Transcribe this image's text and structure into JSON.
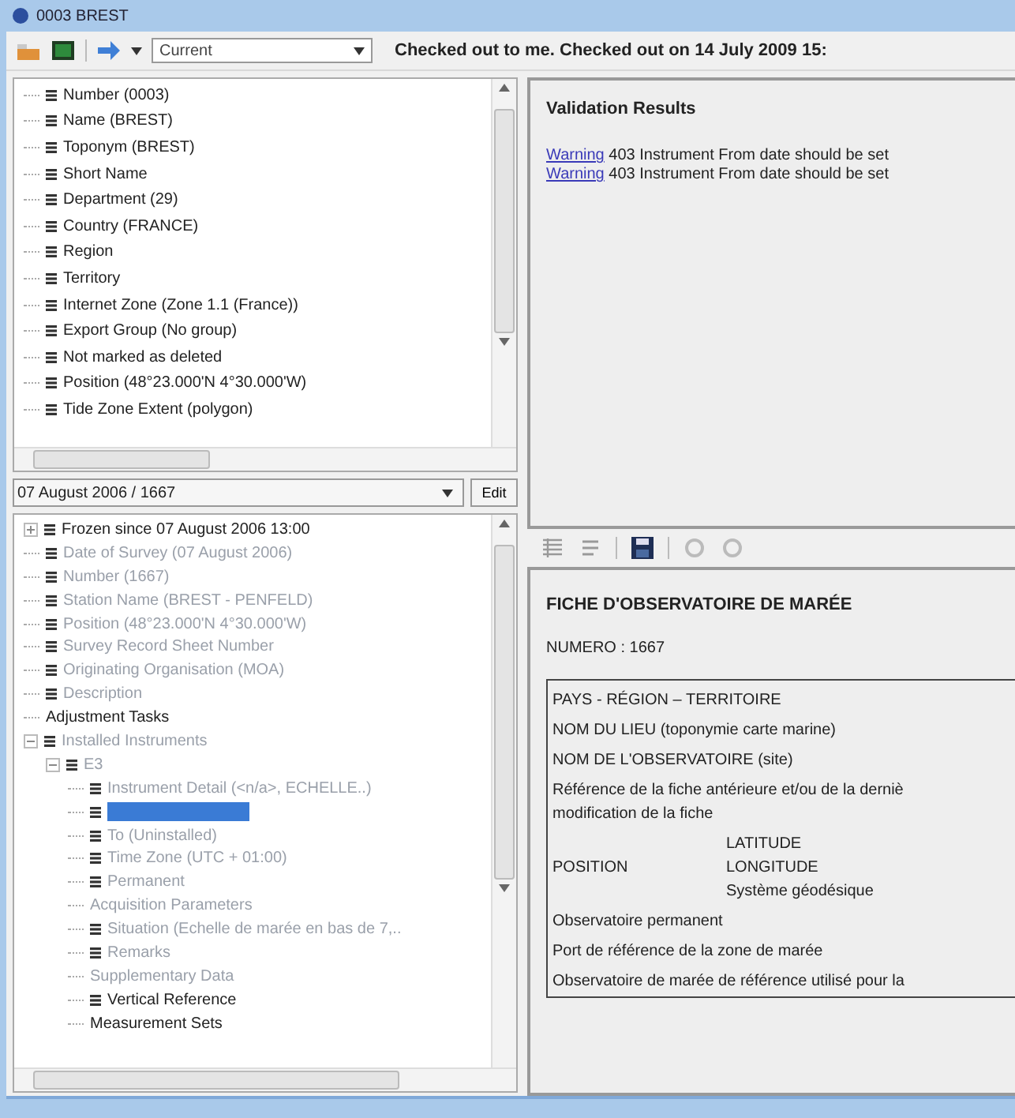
{
  "window": {
    "title": "0003 BREST"
  },
  "toolbar": {
    "combo": "Current",
    "status": "Checked out to me. Checked out on 14 July 2009 15:"
  },
  "upper_tree": {
    "items": [
      {
        "label": "Number (0003)",
        "icon": true,
        "disabled": false,
        "selected": false
      },
      {
        "label": "Name (BREST)",
        "icon": true,
        "disabled": false,
        "selected": false
      },
      {
        "label": "Toponym (BREST)",
        "icon": true,
        "disabled": false,
        "selected": false
      },
      {
        "label": "Short Name",
        "icon": true,
        "disabled": false,
        "selected": false
      },
      {
        "label": "Department (29)",
        "icon": true,
        "disabled": false,
        "selected": false
      },
      {
        "label": "Country (FRANCE)",
        "icon": true,
        "disabled": false,
        "selected": false
      },
      {
        "label": "Region",
        "icon": true,
        "disabled": false,
        "selected": false
      },
      {
        "label": "Territory",
        "icon": true,
        "disabled": false,
        "selected": false
      },
      {
        "label": "Internet Zone (Zone 1.1 (France))",
        "icon": true,
        "disabled": false,
        "selected": false
      },
      {
        "label": "Export Group (No group)",
        "icon": true,
        "disabled": false,
        "selected": false
      },
      {
        "label": "Not marked as deleted",
        "icon": true,
        "disabled": false,
        "selected": false
      },
      {
        "label": "Position (48°23.000'N 4°30.000'W)",
        "icon": true,
        "disabled": false,
        "selected": false
      },
      {
        "label": "Tide Zone Extent (polygon)",
        "icon": true,
        "disabled": false,
        "selected": false
      }
    ]
  },
  "version_selector": {
    "value": "07 August 2006 / 1667",
    "button": "Edit"
  },
  "lower_tree": {
    "items": [
      {
        "label": "Frozen since 07 August 2006 13:00",
        "icon": true,
        "disabled": false,
        "selected": false,
        "expanded": false
      },
      {
        "label": "Date of Survey (07 August 2006)",
        "icon": true,
        "disabled": true,
        "selected": false
      },
      {
        "label": "Number (1667)",
        "icon": true,
        "disabled": true,
        "selected": false
      },
      {
        "label": "Station Name (BREST - PENFELD)",
        "icon": true,
        "disabled": true,
        "selected": false
      },
      {
        "label": "Position (48°23.000'N 4°30.000'W)",
        "icon": true,
        "disabled": true,
        "selected": false
      },
      {
        "label": "Survey Record Sheet Number",
        "icon": true,
        "disabled": true,
        "selected": false
      },
      {
        "label": "Originating Organisation (MOA)",
        "icon": true,
        "disabled": true,
        "selected": false
      },
      {
        "label": "Description",
        "icon": true,
        "disabled": true,
        "selected": false
      },
      {
        "label": "Adjustment Tasks",
        "icon": false,
        "disabled": false,
        "selected": false
      },
      {
        "label": "Installed Instruments",
        "icon": true,
        "disabled": true,
        "selected": false,
        "expanded": true,
        "children": [
          {
            "label": "E3",
            "icon": true,
            "disabled": true,
            "selected": false,
            "expanded": true,
            "children": [
              {
                "label": "Instrument Detail (<n/a>, ECHELLE..)",
                "icon": true,
                "disabled": true,
                "selected": false
              },
              {
                "icon": true,
                "selected": true
              },
              {
                "label": "To (Uninstalled)",
                "icon": true,
                "disabled": true,
                "selected": false
              },
              {
                "label": "Time Zone (UTC + 01:00)",
                "icon": true,
                "disabled": true,
                "selected": false
              },
              {
                "label": "Permanent",
                "icon": true,
                "disabled": true,
                "selected": false
              },
              {
                "label": "Acquisition Parameters",
                "icon": false,
                "disabled": true,
                "selected": false
              },
              {
                "label": "Situation (Echelle de marée en bas de 7,..",
                "icon": true,
                "disabled": true,
                "selected": false
              },
              {
                "label": "Remarks",
                "icon": true,
                "disabled": true,
                "selected": false
              },
              {
                "label": "Supplementary Data",
                "icon": false,
                "disabled": true,
                "selected": false
              },
              {
                "label": "Vertical Reference",
                "icon": true,
                "disabled": false,
                "selected": false
              },
              {
                "label": "Measurement Sets",
                "icon": false,
                "disabled": false,
                "selected": false
              }
            ]
          }
        ]
      }
    ]
  },
  "validation": {
    "title": "Validation Results",
    "results": [
      {
        "link": "Warning",
        "message": "403  Instrument From date should be set"
      },
      {
        "link": "Warning",
        "message": "403  Instrument From date should be set"
      }
    ]
  },
  "document": {
    "title": "FICHE D'OBSERVATOIRE DE MARÉE",
    "number": "NUMERO : 1667",
    "rows": [
      {
        "kind": "text",
        "lines": [
          "PAYS - RÉGION – TERRITOIRE"
        ]
      },
      {
        "kind": "text",
        "lines": [
          "NOM DU LIEU (toponymie carte marine)"
        ]
      },
      {
        "kind": "text",
        "lines": [
          "NOM DE L'OBSERVATOIRE (site)"
        ]
      },
      {
        "kind": "text",
        "lines": [
          "Référence de la fiche antérieure et/ou de la derniè",
          "modification de la fiche"
        ]
      },
      {
        "kind": "split",
        "label": "POSITION",
        "lines": [
          "LATITUDE",
          "LONGITUDE",
          "Système géodésique"
        ]
      },
      {
        "kind": "text",
        "lines": [
          "Observatoire permanent"
        ]
      },
      {
        "kind": "text",
        "lines": [
          "Port de référence de la zone de marée"
        ]
      },
      {
        "kind": "text",
        "lines": [
          "Observatoire de marée de référence utilisé pour la"
        ]
      }
    ]
  }
}
